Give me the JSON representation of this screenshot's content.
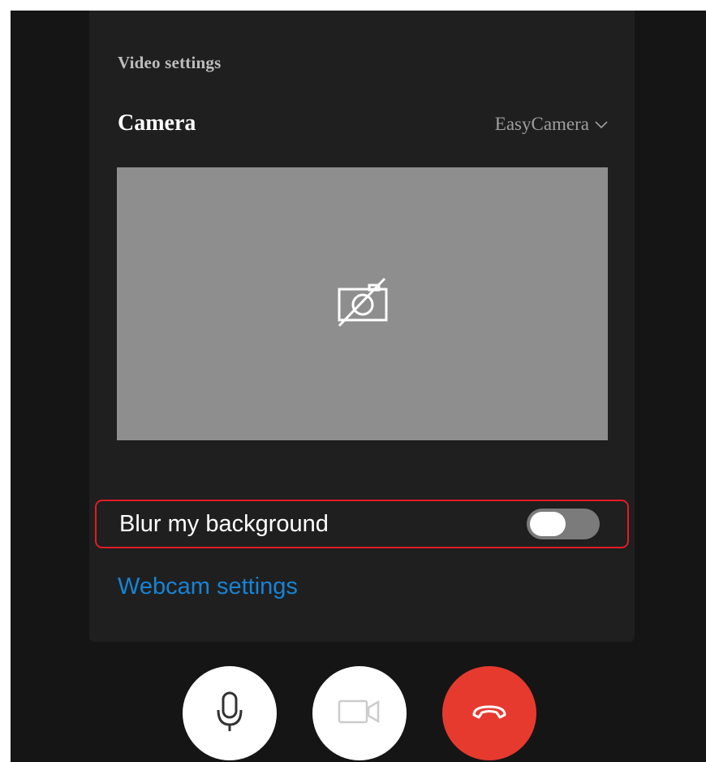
{
  "panel": {
    "title": "Video settings",
    "camera_label": "Camera",
    "camera_selected": "EasyCamera",
    "camera_preview_icon": "camera-off-icon",
    "blur": {
      "label": "Blur my background",
      "enabled": false
    },
    "webcam_settings_link": "Webcam settings"
  },
  "call_controls": [
    {
      "name": "microphone",
      "icon": "microphone-icon"
    },
    {
      "name": "video",
      "icon": "video-camera-icon",
      "state": "disabled"
    },
    {
      "name": "hang-up",
      "icon": "phone-hangup-icon"
    }
  ],
  "colors": {
    "background": "#151515",
    "panel": "#1f1f1f",
    "preview": "#8e8e8e",
    "highlight_border": "#e21b25",
    "link": "#1783d6",
    "hangup": "#e63a2f",
    "toggle_off_track": "#7b7b7b"
  }
}
